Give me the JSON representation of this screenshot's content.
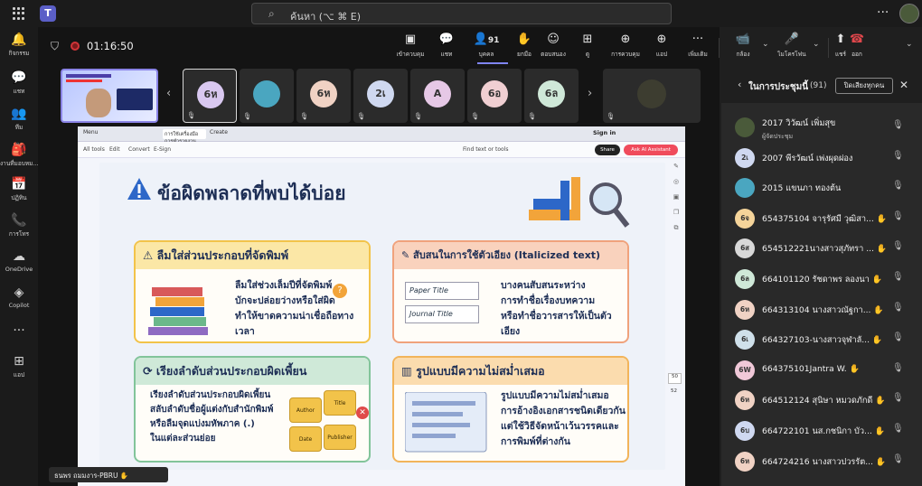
{
  "app": {
    "logo": "teams-logo",
    "search_placeholder": "ค้นหา (⌥ ⌘ E)",
    "more": "···"
  },
  "rail": [
    {
      "icon": "bell-icon",
      "glyph": "🔔",
      "label": "กิจกรรม"
    },
    {
      "icon": "chat-icon",
      "glyph": "💬",
      "label": "แชท"
    },
    {
      "icon": "teams-icon",
      "glyph": "👥",
      "label": "ทีม"
    },
    {
      "icon": "assignments-icon",
      "glyph": "🎒",
      "label": "งานที่มอบหม..."
    },
    {
      "icon": "calendar-icon",
      "glyph": "📅",
      "label": "ปฏิทิน"
    },
    {
      "icon": "phone-icon",
      "glyph": "📞",
      "label": "การโทร"
    },
    {
      "icon": "onedrive-icon",
      "glyph": "☁",
      "label": "OneDrive"
    },
    {
      "icon": "copilot-icon",
      "glyph": "◈",
      "label": "Copilot"
    },
    {
      "icon": "more-icon",
      "glyph": "···",
      "label": ""
    },
    {
      "icon": "add-apps-icon",
      "glyph": "⊞",
      "label": "แอป"
    }
  ],
  "meeting": {
    "timer": "01:16:50",
    "controls": [
      {
        "name": "view-button",
        "glyph": "▣",
        "label": "เข้าควบคุม"
      },
      {
        "name": "chat-button",
        "glyph": "💬",
        "label": "แชท"
      },
      {
        "name": "people-button",
        "glyph": "👤",
        "label": "บุคคล",
        "count": "91"
      },
      {
        "name": "raise-hand-button",
        "glyph": "✋",
        "label": "ยกมือ"
      },
      {
        "name": "react-button",
        "glyph": "☺",
        "label": "ตอบสนอง"
      },
      {
        "name": "view-layout-button",
        "glyph": "⊞",
        "label": "ดู"
      },
      {
        "name": "take-control-button",
        "glyph": "⊕",
        "label": "การควบคุม"
      },
      {
        "name": "apps-button",
        "glyph": "⊕",
        "label": "แอป"
      },
      {
        "name": "more-button",
        "glyph": "···",
        "label": "เพิ่มเติม"
      }
    ],
    "av_controls": [
      {
        "name": "camera-button",
        "glyph": "📹",
        "label": "กล้อง"
      },
      {
        "name": "mic-button",
        "glyph": "🎤",
        "label": "ไมโครโฟน"
      },
      {
        "name": "share-button",
        "glyph": "⬆",
        "label": "แชร์"
      }
    ],
    "leave": {
      "glyph": "☎",
      "label": "ออก"
    }
  },
  "strip": {
    "tiles": [
      {
        "initials": "6ห",
        "color": "#d9c8f0",
        "selected": true
      },
      {
        "initials": "",
        "color": "#4aa6c0",
        "photo": true
      },
      {
        "initials": "6ห",
        "color": "#f0d2c4"
      },
      {
        "initials": "2เ",
        "color": "#cfd8f0"
      },
      {
        "initials": "A",
        "color": "#e6c8e6"
      },
      {
        "initials": "6อ",
        "color": "#f0cfd2"
      },
      {
        "initials": "6ล",
        "color": "#cfe8d8"
      }
    ],
    "last_tile_photo": true
  },
  "panel": {
    "title": "ในการประชุมนี้",
    "count": "(91)",
    "mute_all": "ปิดเสียงทุกคน",
    "participants": [
      {
        "initials": "",
        "color": "#4a5a3a",
        "name": "2017 วิวัฒน์ เพิ่มสุข",
        "sub": "ผู้จัดประชุม"
      },
      {
        "initials": "2เ",
        "color": "#cfd8f0",
        "name": "2007 พีรวัฒน์ เพ่งผุดผ่อง",
        "sub": ""
      },
      {
        "initials": "",
        "color": "#4aa6c0",
        "name": "2015 แขนภา ทองต้น",
        "sub": ""
      },
      {
        "initials": "6จ",
        "color": "#f5d49a",
        "name": "654375104 จารุรัศมี วุฒิสา...",
        "sub": "",
        "hand": true
      },
      {
        "initials": "6ส",
        "color": "#d8d8d8",
        "name": "654512221นางสาวสุภัทรา ...",
        "sub": "",
        "hand": true
      },
      {
        "initials": "6ล",
        "color": "#cfe8d8",
        "name": "664101120 รัชดาพร ลองนา",
        "sub": "",
        "hand": true
      },
      {
        "initials": "6ห",
        "color": "#f0d2c4",
        "name": "664313104 นางสาวณัฐกา...",
        "sub": "",
        "hand": true
      },
      {
        "initials": "6เ",
        "color": "#cfe0ea",
        "name": "664327103-นางสาวจุฬาลั...",
        "sub": "",
        "hand": true
      },
      {
        "initials": "6W",
        "color": "#f0c8d8",
        "name": "664375101Jantra W.",
        "sub": "",
        "hand": true
      },
      {
        "initials": "6ห",
        "color": "#f0d2c4",
        "name": "664512124 สุนิษา หมวดภักดี",
        "sub": "",
        "hand": true
      },
      {
        "initials": "6บ",
        "color": "#cfd8f0",
        "name": "664722101 นส.กชนิกา บัว...",
        "sub": "",
        "hand": true
      },
      {
        "initials": "6ห",
        "color": "#f0d2c4",
        "name": "664724216 นางสาวปวรรัต...",
        "sub": "",
        "hand": true
      }
    ]
  },
  "browser": {
    "tab1": "Menu",
    "tab2": "การใช้เครื่องมือการทำรายงาน...",
    "newtab": "Create",
    "signin": "Sign in",
    "toolbar": [
      "All tools",
      "Edit",
      "Convert",
      "E-Sign"
    ],
    "find": "Find text or tools",
    "share": "Share",
    "ask": "Ask AI Assistant",
    "page": "50",
    "total": "52"
  },
  "slide": {
    "title": "ข้อผิดพลาดที่พบได้บ่อย",
    "cards": [
      {
        "heading": "ลืมใส่ส่วนประกอบที่จัดพิมพ์",
        "lines": [
          "ลืมใส่ช่วงเล็มปีที่จัดพิมพ์",
          "บักจะปล่อยว่างหรือใส่ผิด",
          "ทำให้ขาดความน่าเชื่อถือทางเวลา"
        ]
      },
      {
        "heading": "สับสนในการใช้ตัวเอียง (Italicized text)",
        "lines": [
          "บางคนสับสนระหว่าง",
          "การทำชื่อเรื่องบทความ",
          "หรือทำชื่อวารสารให้เป็นตัวเอียง"
        ],
        "paper": "Paper Title",
        "journal": "Journal Title"
      },
      {
        "heading": "เรียงลำดับส่วนประกอบผิดเพี้ยน",
        "lines": [
          "เรียงลำดับส่วนประกอบผิดเพี้ยน",
          "สลับลำดับชื่อผู้แต่งกับสำนักพิมพ์",
          "หรือลืมจุดแบ่งมหัพภาค (.)",
          "ในแต่ละส่วนย่อย"
        ],
        "puzzle": [
          "Author",
          "Title",
          "Date",
          "Publisher"
        ]
      },
      {
        "heading": "รูปแบบมีความไม่สม่ำเสมอ",
        "lines": [
          "รูปแบบมีความไม่สม่ำเสมอ",
          "การอ้างอิงเอกสารชนิดเดียวกัน",
          "แต่ใช้วิธีจัดหน้าเว้นวรรคและ",
          "การพิมพ์ที่ต่างกัน"
        ]
      }
    ]
  },
  "presenter": {
    "name": "ธนพร ถมมงาร-PBRU"
  },
  "colors": {
    "accent": "#7f85f5",
    "leave": "#d13438",
    "slide_title": "#1d2e55"
  }
}
